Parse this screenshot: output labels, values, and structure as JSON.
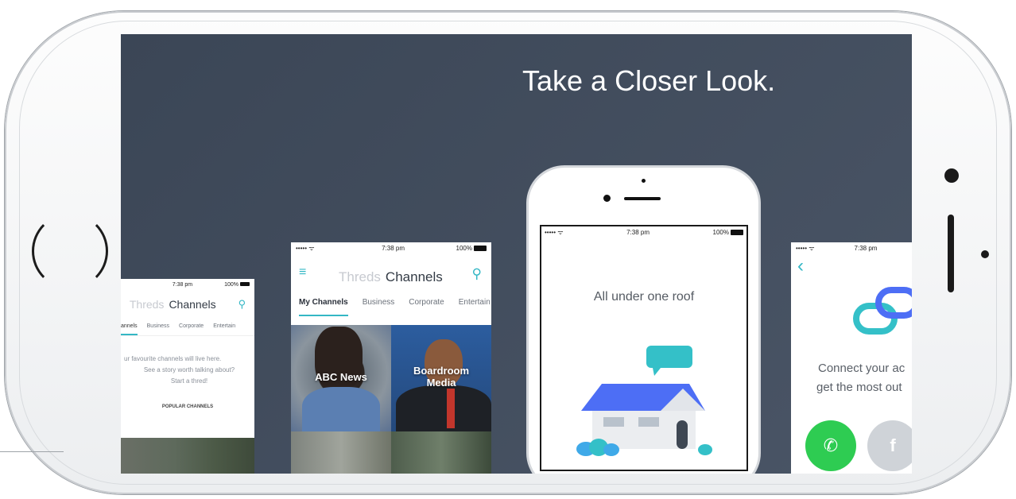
{
  "headline": "Take a Closer Look.",
  "phone_a": {
    "time": "7:38 pm",
    "battery": "100%",
    "title_faded": "Threds",
    "title": "Channels",
    "tabs": [
      "annels",
      "Business",
      "Corporate",
      "Entertain"
    ],
    "empty_line1": "ur favourite channels will live here.",
    "empty_line2": "See a story worth talking about?",
    "empty_line3": "Start a thred!",
    "section": "POPULAR CHANNELS"
  },
  "phone_b": {
    "signal": "••••• ᯤ",
    "time": "7:38 pm",
    "battery": "100%",
    "title_faded": "Threds",
    "title": "Channels",
    "tabs": [
      "My Channels",
      "Business",
      "Corporate",
      "Entertain"
    ],
    "tiles": [
      {
        "label": "ABC News"
      },
      {
        "label": "Boardroom Media"
      }
    ]
  },
  "phone_c": {
    "signal": "••••• ᯤ",
    "time": "7:38 pm",
    "battery": "100%",
    "message": "All under one roof"
  },
  "phone_d": {
    "signal": "••••• ᯤ",
    "time": "7:38 pm",
    "back": "‹",
    "line1": "Connect your ac",
    "line2": "get the most out",
    "fb": "f"
  },
  "colors": {
    "screen_bg": "#414c5c",
    "teal": "#34b7c5",
    "green": "#2ecc52",
    "house_blue": "#4f6ef7"
  }
}
